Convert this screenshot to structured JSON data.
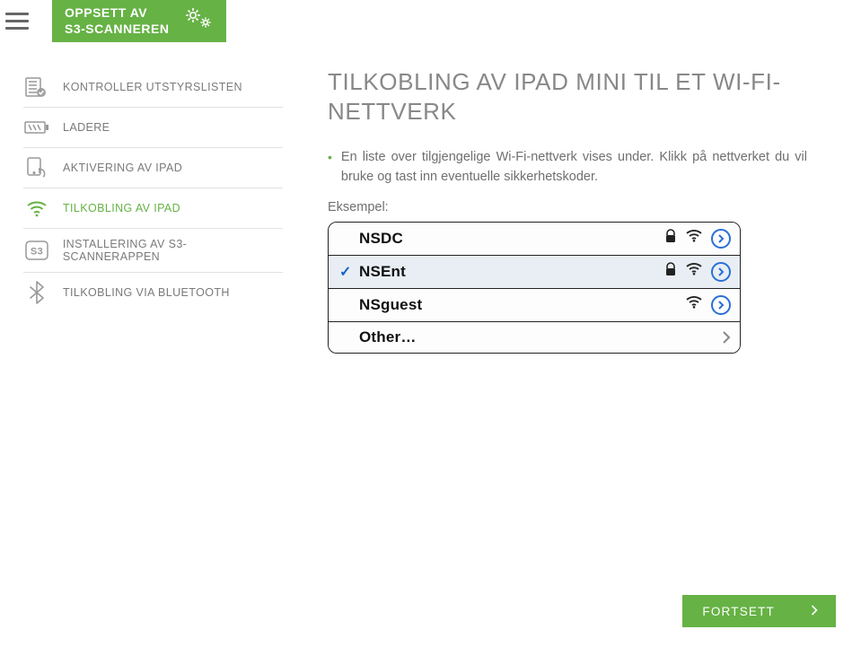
{
  "header": {
    "title": "OPPSETT AV\nS3-SCANNEREN"
  },
  "sidebar": {
    "items": [
      {
        "label": "KONTROLLER UTSTYRSLISTEN"
      },
      {
        "label": "LADERE"
      },
      {
        "label": "AKTIVERING AV IPAD"
      },
      {
        "label": "TILKOBLING AV IPAD"
      },
      {
        "label": "INSTALLERING AV S3-SCANNERAPPEN"
      },
      {
        "label": "TILKOBLING VIA BLUETOOTH"
      }
    ]
  },
  "main": {
    "title": "TILKOBLING AV IPAD MINI TIL ET WI-FI-NETTVERK",
    "bullet_text": "En liste over tilgjengelige Wi-Fi-nettverk vises under. Klikk på nettverket du vil bruke og tast inn eventuelle sikkerhetskoder.",
    "example_label": "Eksempel:"
  },
  "wifi": {
    "rows": [
      {
        "ssid": "NSDC",
        "locked": true,
        "wifi": true,
        "arrow": "blue",
        "selected": false
      },
      {
        "ssid": "NSEnt",
        "locked": true,
        "wifi": true,
        "arrow": "blue",
        "selected": true
      },
      {
        "ssid": "NSguest",
        "locked": false,
        "wifi": true,
        "arrow": "blue",
        "selected": false
      },
      {
        "ssid": "Other…",
        "locked": false,
        "wifi": false,
        "arrow": "grey",
        "selected": false
      }
    ]
  },
  "footer": {
    "continue_label": "FORTSETT"
  },
  "colors": {
    "accent": "#66b245"
  }
}
